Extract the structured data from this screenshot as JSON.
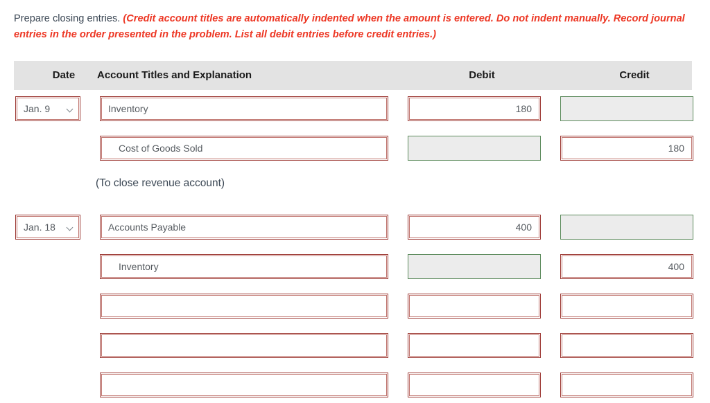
{
  "instructions": {
    "lead": "Prepare closing entries.",
    "note": "(Credit account titles are automatically indented when the amount is entered. Do not indent manually. Record journal entries in the order presented in the problem. List all debit entries before credit entries.)"
  },
  "colors": {
    "note_red": "#ed3724",
    "field_border_outer": "#9e3b36",
    "field_border_inner": "#c0756f",
    "disabled_border": "#5b8a5b",
    "disabled_fill": "#ececec",
    "header_band": "#e3e3e3",
    "text": "#3b4754"
  },
  "table": {
    "headers": {
      "date": "Date",
      "account": "Account Titles and Explanation",
      "debit": "Debit",
      "credit": "Credit"
    },
    "rows": [
      {
        "kind": "entry",
        "date": "Jan. 9",
        "has_date": true,
        "account": "Inventory",
        "indent": false,
        "debit": "180",
        "credit": "",
        "debit_state": "editable",
        "credit_state": "disabled"
      },
      {
        "kind": "entry",
        "date": "",
        "has_date": false,
        "account": "Cost of Goods Sold",
        "indent": true,
        "debit": "",
        "credit": "180",
        "debit_state": "disabled",
        "credit_state": "editable"
      },
      {
        "kind": "explanation",
        "text": "(To close revenue account)"
      },
      {
        "kind": "entry",
        "date": "Jan. 18",
        "has_date": true,
        "account": "Accounts Payable",
        "indent": false,
        "debit": "400",
        "credit": "",
        "debit_state": "editable",
        "credit_state": "disabled"
      },
      {
        "kind": "entry",
        "date": "",
        "has_date": false,
        "account": "Inventory",
        "indent": true,
        "debit": "",
        "credit": "400",
        "debit_state": "disabled",
        "credit_state": "editable"
      },
      {
        "kind": "entry",
        "date": "",
        "has_date": false,
        "account": "",
        "indent": false,
        "debit": "",
        "credit": "",
        "debit_state": "editable",
        "credit_state": "editable"
      },
      {
        "kind": "entry",
        "date": "",
        "has_date": false,
        "account": "",
        "indent": false,
        "debit": "",
        "credit": "",
        "debit_state": "editable",
        "credit_state": "editable"
      },
      {
        "kind": "entry",
        "date": "",
        "has_date": false,
        "account": "",
        "indent": false,
        "debit": "",
        "credit": "",
        "debit_state": "editable",
        "credit_state": "editable"
      }
    ]
  }
}
